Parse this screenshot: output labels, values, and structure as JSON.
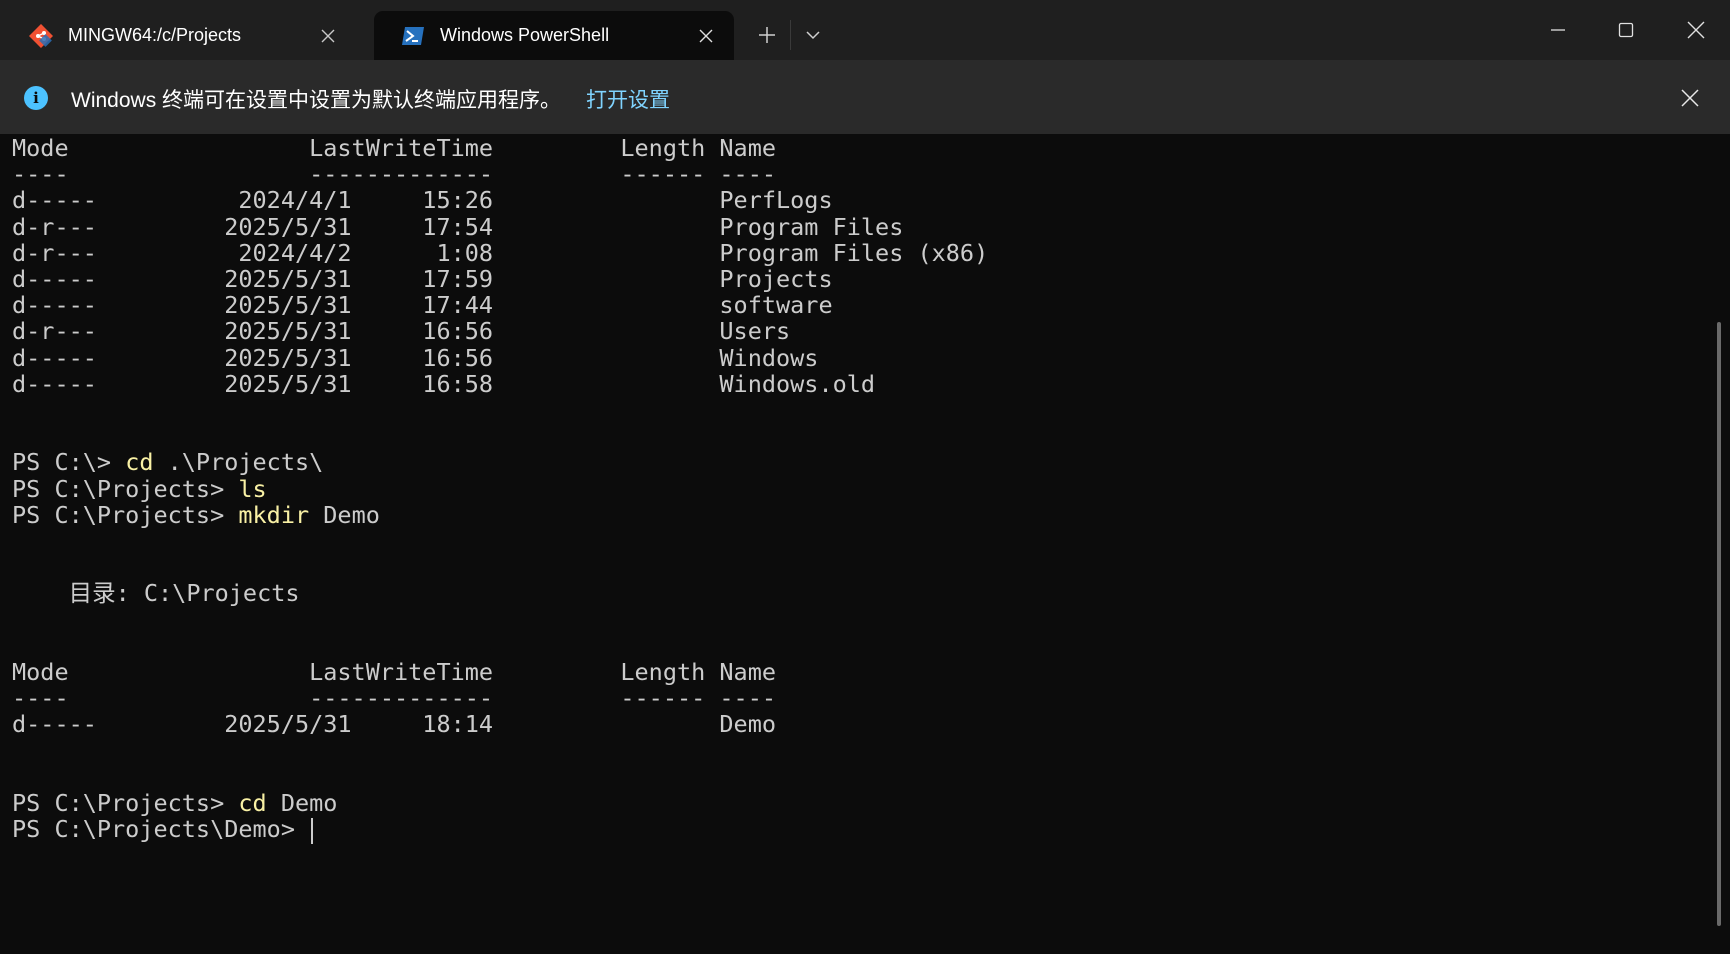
{
  "tabs": [
    {
      "label": "MINGW64:/c/Projects",
      "icon": "git-bash-icon",
      "active": false
    },
    {
      "label": "Windows PowerShell",
      "icon": "powershell-icon",
      "active": true
    }
  ],
  "infobar": {
    "icon": "info-icon",
    "message": "Windows 终端可在设置中设置为默认终端应用程序。",
    "link": "打开设置"
  },
  "colors": {
    "background": "#0c0c0c",
    "text": "#cccccc",
    "command": "#f9f1a5",
    "link": "#80d4ff",
    "info_accent": "#4cc2ff"
  },
  "terminal": {
    "lines": [
      {
        "text": "Mode                 LastWriteTime         Length Name"
      },
      {
        "text": "----                 -------------         ------ ----"
      },
      {
        "text": "d-----          2024/4/1     15:26                PerfLogs"
      },
      {
        "text": "d-r---         2025/5/31     17:54                Program Files"
      },
      {
        "text": "d-r---          2024/4/2      1:08                Program Files (x86)"
      },
      {
        "text": "d-----         2025/5/31     17:59                Projects"
      },
      {
        "text": "d-----         2025/5/31     17:44                software"
      },
      {
        "text": "d-r---         2025/5/31     16:56                Users"
      },
      {
        "text": "d-----         2025/5/31     16:56                Windows"
      },
      {
        "text": "d-----         2025/5/31     16:58                Windows.old"
      },
      {
        "text": ""
      },
      {
        "text": ""
      },
      {
        "prompt": "PS C:\\> ",
        "cmd": "cd",
        "args": " .\\Projects\\"
      },
      {
        "prompt": "PS C:\\Projects> ",
        "cmd": "ls",
        "args": ""
      },
      {
        "prompt": "PS C:\\Projects> ",
        "cmd": "mkdir",
        "args": " Demo"
      },
      {
        "text": ""
      },
      {
        "text": ""
      },
      {
        "text": "    目录: C:\\Projects"
      },
      {
        "text": ""
      },
      {
        "text": ""
      },
      {
        "text": "Mode                 LastWriteTime         Length Name"
      },
      {
        "text": "----                 -------------         ------ ----"
      },
      {
        "text": "d-----         2025/5/31     18:14                Demo"
      },
      {
        "text": ""
      },
      {
        "text": ""
      },
      {
        "prompt": "PS C:\\Projects> ",
        "cmd": "cd",
        "args": " Demo"
      },
      {
        "prompt": "PS C:\\Projects\\Demo> ",
        "cmd": "",
        "args": "",
        "cursor": true
      }
    ]
  }
}
